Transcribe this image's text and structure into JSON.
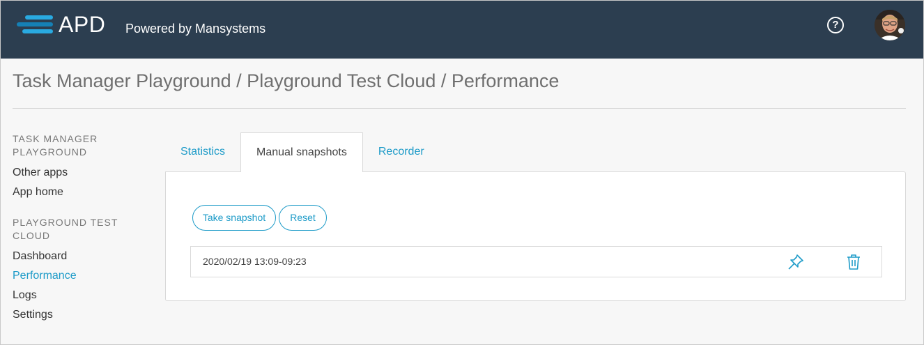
{
  "header": {
    "logo_text": "APD",
    "tagline": "Powered by Mansystems",
    "help_label": "?",
    "logo_icon": "apd-logo-icon",
    "help_icon": "question-circle-icon",
    "avatar_icon": "user-avatar",
    "colors": {
      "bar": "#2c3e50",
      "logo": "#29aae1"
    }
  },
  "breadcrumb": "Task Manager Playground / Playground Test Cloud / Performance",
  "sidebar": {
    "group1": {
      "heading": "TASK MANAGER PLAYGROUND",
      "items": [
        {
          "label": "Other apps"
        },
        {
          "label": "App home"
        }
      ]
    },
    "group2": {
      "heading": "PLAYGROUND TEST CLOUD",
      "items": [
        {
          "label": "Dashboard"
        },
        {
          "label": "Performance"
        },
        {
          "label": "Logs"
        },
        {
          "label": "Settings"
        }
      ]
    }
  },
  "tabs": [
    {
      "label": "Statistics"
    },
    {
      "label": "Manual snapshots"
    },
    {
      "label": "Recorder"
    }
  ],
  "active_tab": "Manual snapshots",
  "panel": {
    "take_snapshot_label": "Take snapshot",
    "reset_label": "Reset",
    "snapshots": [
      {
        "label": "2020/02/19 13:09-09:23",
        "pin_icon": "pin-icon",
        "delete_icon": "trash-icon"
      }
    ]
  },
  "accent_color": "#1d9bc8"
}
